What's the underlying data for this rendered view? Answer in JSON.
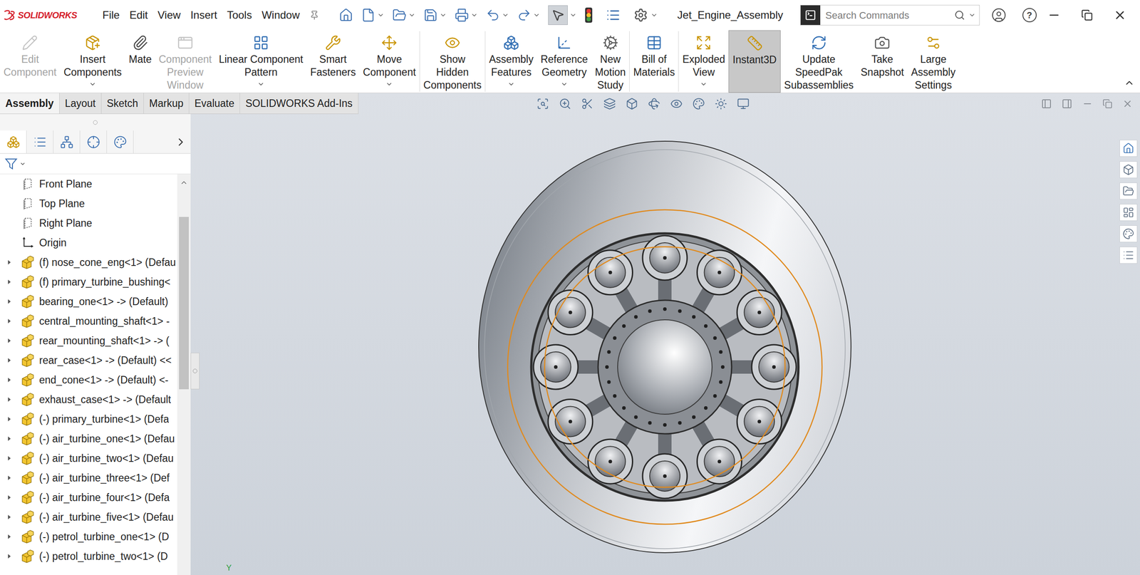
{
  "app": {
    "logo": "SOLIDWORKS"
  },
  "menus": [
    "File",
    "Edit",
    "View",
    "Insert",
    "Tools",
    "Window"
  ],
  "window": {
    "title": "Jet_Engine_Assembly"
  },
  "search": {
    "placeholder": "Search Commands"
  },
  "help_glyph": "?",
  "ribbon": [
    {
      "lines": [
        "Edit",
        "Component"
      ],
      "disabled": true,
      "dropdown": false,
      "selected": false,
      "group": 1
    },
    {
      "lines": [
        "Insert",
        "Components"
      ],
      "disabled": false,
      "dropdown": true,
      "selected": false,
      "group": 1
    },
    {
      "lines": [
        "Mate"
      ],
      "disabled": false,
      "dropdown": false,
      "selected": false,
      "group": 1
    },
    {
      "lines": [
        "Component",
        "Preview",
        "Window"
      ],
      "disabled": true,
      "dropdown": false,
      "selected": false,
      "group": 1
    },
    {
      "lines": [
        "Linear Component",
        "Pattern"
      ],
      "disabled": false,
      "dropdown": true,
      "selected": false,
      "group": 1
    },
    {
      "lines": [
        "Smart",
        "Fasteners"
      ],
      "disabled": false,
      "dropdown": false,
      "selected": false,
      "group": 1
    },
    {
      "lines": [
        "Move",
        "Component"
      ],
      "disabled": false,
      "dropdown": true,
      "selected": false,
      "group": 1
    },
    {
      "lines": [
        "Show",
        "Hidden",
        "Components"
      ],
      "disabled": false,
      "dropdown": false,
      "selected": false,
      "group": 2
    },
    {
      "lines": [
        "Assembly",
        "Features"
      ],
      "disabled": false,
      "dropdown": true,
      "selected": false,
      "group": 3
    },
    {
      "lines": [
        "Reference",
        "Geometry"
      ],
      "disabled": false,
      "dropdown": true,
      "selected": false,
      "group": 3
    },
    {
      "lines": [
        "New",
        "Motion",
        "Study"
      ],
      "disabled": false,
      "dropdown": false,
      "selected": false,
      "group": 3
    },
    {
      "lines": [
        "Bill of",
        "Materials"
      ],
      "disabled": false,
      "dropdown": false,
      "selected": false,
      "group": 4
    },
    {
      "lines": [
        "Exploded",
        "View"
      ],
      "disabled": false,
      "dropdown": true,
      "selected": false,
      "group": 5
    },
    {
      "lines": [
        "Instant3D"
      ],
      "disabled": false,
      "dropdown": false,
      "selected": true,
      "group": 5
    },
    {
      "lines": [
        "Update",
        "SpeedPak",
        "Subassemblies"
      ],
      "disabled": false,
      "dropdown": false,
      "selected": false,
      "group": 5
    },
    {
      "lines": [
        "Take",
        "Snapshot"
      ],
      "disabled": false,
      "dropdown": false,
      "selected": false,
      "group": 5
    },
    {
      "lines": [
        "Large",
        "Assembly",
        "Settings"
      ],
      "disabled": false,
      "dropdown": false,
      "selected": false,
      "group": 5
    }
  ],
  "tabs": [
    {
      "label": "Assembly",
      "selected": true
    },
    {
      "label": "Layout",
      "selected": false
    },
    {
      "label": "Sketch",
      "selected": false
    },
    {
      "label": "Markup",
      "selected": false
    },
    {
      "label": "Evaluate",
      "selected": false
    },
    {
      "label": "SOLIDWORKS Add-Ins",
      "selected": false
    }
  ],
  "tree": [
    {
      "label": "Front Plane",
      "kind": "plane",
      "expandable": false
    },
    {
      "label": "Top Plane",
      "kind": "plane",
      "expandable": false
    },
    {
      "label": "Right Plane",
      "kind": "plane",
      "expandable": false
    },
    {
      "label": "Origin",
      "kind": "origin",
      "expandable": false
    },
    {
      "label": "(f) nose_cone_eng<1> (Defau",
      "kind": "component",
      "expandable": true
    },
    {
      "label": "(f) primary_turbine_bushing<",
      "kind": "component",
      "expandable": true
    },
    {
      "label": "bearing_one<1> -> (Default)",
      "kind": "component",
      "expandable": true
    },
    {
      "label": "central_mounting_shaft<1> -",
      "kind": "component",
      "expandable": true
    },
    {
      "label": "rear_mounting_shaft<1> -> (",
      "kind": "component",
      "expandable": true
    },
    {
      "label": "rear_case<1> -> (Default) <<",
      "kind": "component",
      "expandable": true
    },
    {
      "label": "end_cone<1> -> (Default) <-",
      "kind": "component",
      "expandable": true
    },
    {
      "label": "exhaust_case<1> -> (Default",
      "kind": "component",
      "expandable": true
    },
    {
      "label": "(-) primary_turbine<1> (Defa",
      "kind": "component",
      "expandable": true
    },
    {
      "label": "(-) air_turbine_one<1> (Defau",
      "kind": "component",
      "expandable": true
    },
    {
      "label": "(-) air_turbine_two<1> (Defau",
      "kind": "component",
      "expandable": true
    },
    {
      "label": "(-) air_turbine_three<1> (Def",
      "kind": "component",
      "expandable": true
    },
    {
      "label": "(-) air_turbine_four<1> (Defa",
      "kind": "component",
      "expandable": true
    },
    {
      "label": "(-) air_turbine_five<1> (Defau",
      "kind": "component",
      "expandable": true
    },
    {
      "label": "(-) petrol_turbine_one<1> (D",
      "kind": "component",
      "expandable": true
    },
    {
      "label": "(-) petrol_turbine_two<1> (D",
      "kind": "component",
      "expandable": true
    }
  ],
  "scrollbar": {
    "offset": 0.107,
    "size": 0.43
  },
  "triad": {
    "axis_label": "Y"
  }
}
